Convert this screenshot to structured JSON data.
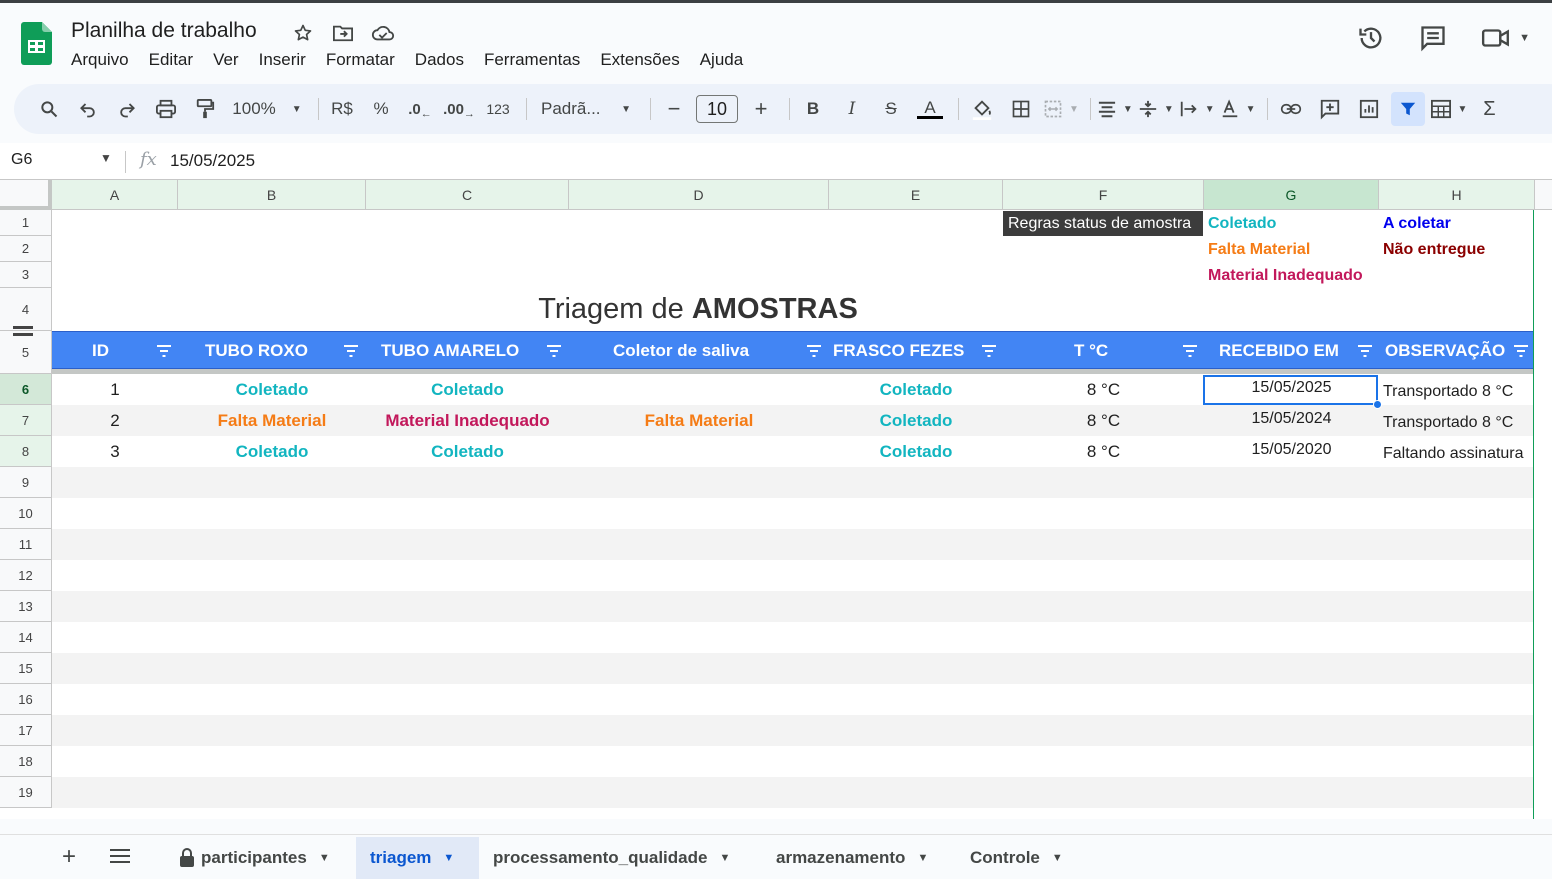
{
  "app": {
    "doc_title": "Planilha de trabalho",
    "menu": [
      "Arquivo",
      "Editar",
      "Ver",
      "Inserir",
      "Formatar",
      "Dados",
      "Ferramentas",
      "Extensões",
      "Ajuda"
    ]
  },
  "toolbar": {
    "zoom": "100%",
    "currency": "R$",
    "percent": "%",
    "dec_decrease": ".0",
    "dec_increase": ".00",
    "number_format": "123",
    "font_name": "Padrã...",
    "font_size": "10",
    "bold": "B",
    "italic": "I",
    "text_color": "A"
  },
  "formula_bar": {
    "cell_ref": "G6",
    "fx": "fx",
    "value": "15/05/2025"
  },
  "columns": [
    "A",
    "B",
    "C",
    "D",
    "E",
    "F",
    "G",
    "H"
  ],
  "rows": [
    "1",
    "2",
    "3",
    "4",
    "5",
    "6",
    "7",
    "8",
    "9",
    "10",
    "11",
    "12",
    "13",
    "14",
    "15",
    "16",
    "17",
    "18",
    "19"
  ],
  "legend": {
    "label": "Regras status de amostra",
    "coletado": "Coletado",
    "falta_material": "Falta Material",
    "material_inadequado": "Material Inadequado",
    "a_coletar": "A coletar",
    "nao_entregue": "Não entregue"
  },
  "title": {
    "normal": "Triagem de ",
    "bold": "AMOSTRAS"
  },
  "table": {
    "headers": [
      "ID",
      "TUBO ROXO",
      "TUBO AMARELO",
      "Coletor de saliva",
      "FRASCO FEZES",
      "T °C",
      "RECEBIDO EM",
      "OBSERVAÇÃO"
    ],
    "rows": [
      [
        "1",
        "Coletado",
        "Coletado",
        "",
        "Coletado",
        "8 °C",
        "15/05/2025",
        "Transportado 8 °C"
      ],
      [
        "2",
        "Falta Material",
        "Material Inadequado",
        "Falta Material",
        "Coletado",
        "8 °C",
        "15/05/2024",
        "Transportado 8 °C"
      ],
      [
        "3",
        "Coletado",
        "Coletado",
        "",
        "Coletado",
        "8 °C",
        "15/05/2020",
        "Faltando assinatura"
      ]
    ]
  },
  "status_colors": {
    "Coletado": "#12b5c0",
    "Falta Material": "#f57c16",
    "Material Inadequado": "#c2185b",
    "A coletar": "#0000ee",
    "Não entregue": "#8b0000"
  },
  "sheets": {
    "tabs": [
      "participantes",
      "triagem",
      "processamento_qualidade",
      "armazenamento",
      "Controle"
    ],
    "active": "triagem"
  }
}
